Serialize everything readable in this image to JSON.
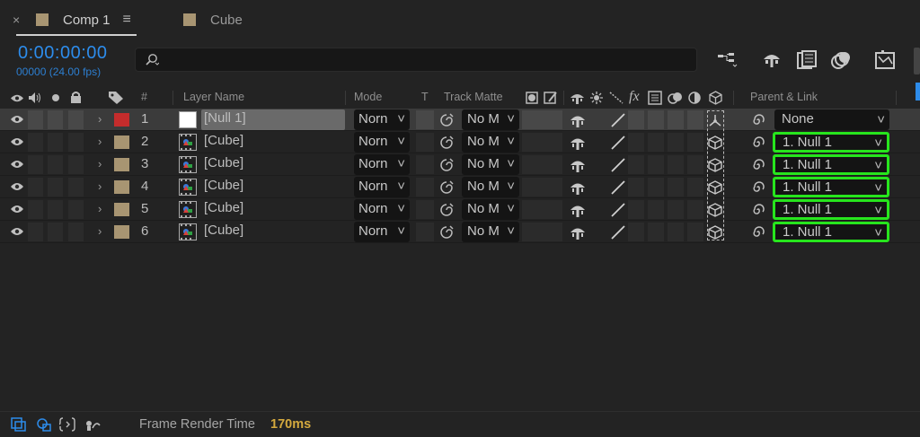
{
  "tabs": [
    {
      "label": "Comp 1",
      "active": true,
      "color": "#a89572"
    },
    {
      "label": "Cube",
      "active": false,
      "color": "#a89572"
    }
  ],
  "close_glyph": "×",
  "menu_glyph": "≡",
  "timecode": "0:00:00:00",
  "fps": "00000 (24.00 fps)",
  "search": {
    "placeholder": ""
  },
  "columns": {
    "hash": "#",
    "layer_name": "Layer Name",
    "mode": "Mode",
    "t": "T",
    "track_matte": "Track Matte",
    "fx": "fx",
    "parent_link": "Parent & Link"
  },
  "layers": [
    {
      "num": "1",
      "name": "[Null 1]",
      "mode": "Norn",
      "matte": "No M",
      "parent": "None",
      "label_color": "#c42c2c",
      "type": "null",
      "selected": true,
      "highlight": false
    },
    {
      "num": "2",
      "name": "[Cube]",
      "mode": "Norn",
      "matte": "No M",
      "parent": "1. Null 1",
      "label_color": "#a89572",
      "type": "comp",
      "selected": false,
      "highlight": true
    },
    {
      "num": "3",
      "name": "[Cube]",
      "mode": "Norn",
      "matte": "No M",
      "parent": "1. Null 1",
      "label_color": "#a89572",
      "type": "comp",
      "selected": false,
      "highlight": true
    },
    {
      "num": "4",
      "name": "[Cube]",
      "mode": "Norn",
      "matte": "No M",
      "parent": "1. Null 1",
      "label_color": "#a89572",
      "type": "comp",
      "selected": false,
      "highlight": true
    },
    {
      "num": "5",
      "name": "[Cube]",
      "mode": "Norn",
      "matte": "No M",
      "parent": "1. Null 1",
      "label_color": "#a89572",
      "type": "comp",
      "selected": false,
      "highlight": true
    },
    {
      "num": "6",
      "name": "[Cube]",
      "mode": "Norn",
      "matte": "No M",
      "parent": "1. Null 1",
      "label_color": "#a89572",
      "type": "comp",
      "selected": false,
      "highlight": true
    }
  ],
  "footer": {
    "frame_render_label": "Frame Render Time",
    "frame_render_value": "170ms"
  },
  "colors": {
    "accent_blue": "#2d8ceb",
    "highlight_green": "#27e51d",
    "render_time": "#d4a93e"
  }
}
